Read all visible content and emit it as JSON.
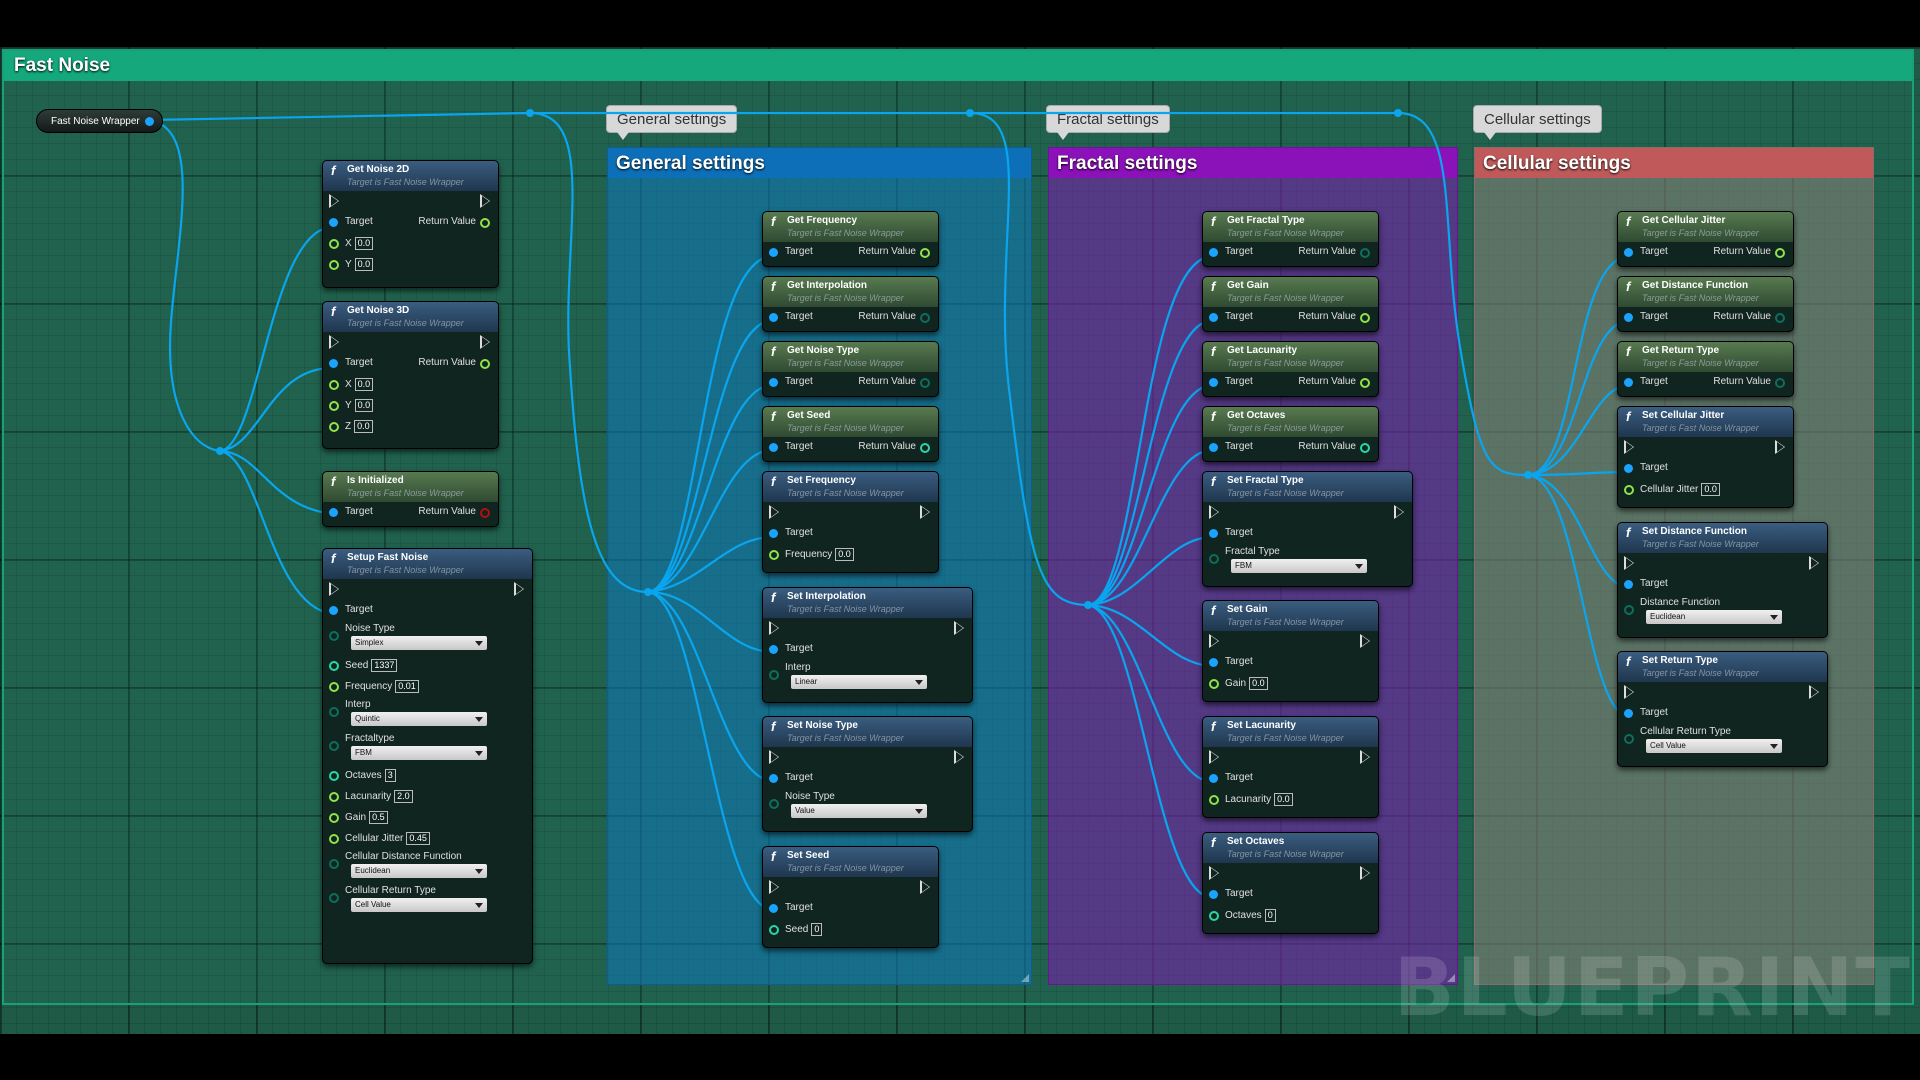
{
  "comment_title": "Fast Noise",
  "reroute_label": "Fast Noise Wrapper",
  "watermark": "BLUEPRINT",
  "target_subtitle": "Target is Fast Noise Wrapper",
  "groups": {
    "general": {
      "bubble": "General settings",
      "title": "General settings",
      "color": "#0d6fb8"
    },
    "fractal": {
      "bubble": "Fractal settings",
      "title": "Fractal settings",
      "color": "#8b12b8"
    },
    "cellular": {
      "bubble": "Cellular settings",
      "title": "Cellular settings",
      "color": "#c05a5a"
    }
  },
  "labels": {
    "target": "Target",
    "return_value": "Return Value",
    "x": "X",
    "y": "Y",
    "z": "Z",
    "noise_type": "Noise Type",
    "seed": "Seed",
    "frequency": "Frequency",
    "interp": "Interp",
    "fractaltype": "Fractaltype",
    "fractal_type": "Fractal Type",
    "octaves": "Octaves",
    "lacunarity": "Lacunarity",
    "gain": "Gain",
    "cellular_jitter": "Cellular Jitter",
    "cellular_distance_function": "Cellular Distance Function",
    "cellular_return_type": "Cellular Return Type",
    "distance_function": "Distance Function"
  },
  "left_nodes": {
    "get_noise_2d": {
      "title": "Get Noise 2D",
      "x": "0.0",
      "y": "0.0"
    },
    "get_noise_3d": {
      "title": "Get Noise 3D",
      "x": "0.0",
      "y": "0.0",
      "z": "0.0"
    },
    "is_initialized": {
      "title": "Is Initialized"
    },
    "setup": {
      "title": "Setup Fast Noise",
      "noise_type": "Simplex",
      "seed": "1337",
      "frequency": "0.01",
      "interp": "Quintic",
      "fractaltype": "FBM",
      "octaves": "3",
      "lacunarity": "2.0",
      "gain": "0.5",
      "cellular_jitter": "0.45",
      "cellular_distance_function": "Euclidean",
      "cellular_return_type": "Cell Value"
    }
  },
  "general_nodes": {
    "get_frequency": "Get Frequency",
    "get_interpolation": "Get Interpolation",
    "get_noise_type": "Get Noise Type",
    "get_seed": "Get Seed",
    "set_frequency": {
      "title": "Set Frequency",
      "value": "0.0"
    },
    "set_interpolation": {
      "title": "Set Interpolation",
      "value": "Linear"
    },
    "set_noise_type": {
      "title": "Set Noise Type",
      "value": "Value"
    },
    "set_seed": {
      "title": "Set Seed",
      "value": "0"
    }
  },
  "fractal_nodes": {
    "get_fractal_type": "Get Fractal Type",
    "get_gain": "Get Gain",
    "get_lacunarity": "Get Lacunarity",
    "get_octaves": "Get Octaves",
    "set_fractal_type": {
      "title": "Set Fractal Type",
      "value": "FBM"
    },
    "set_gain": {
      "title": "Set Gain",
      "value": "0.0"
    },
    "set_lacunarity": {
      "title": "Set Lacunarity",
      "value": "0.0"
    },
    "set_octaves": {
      "title": "Set Octaves",
      "value": "0"
    }
  },
  "cellular_nodes": {
    "get_cellular_jitter": "Get Cellular Jitter",
    "get_distance_function": "Get Distance Function",
    "get_return_type": "Get Return Type",
    "set_cellular_jitter": {
      "title": "Set Cellular Jitter",
      "value": "0.0"
    },
    "set_distance_function": {
      "title": "Set Distance Function",
      "value": "Euclidean"
    },
    "set_return_type": {
      "title": "Set Return Type",
      "value": "Cell Value"
    }
  }
}
